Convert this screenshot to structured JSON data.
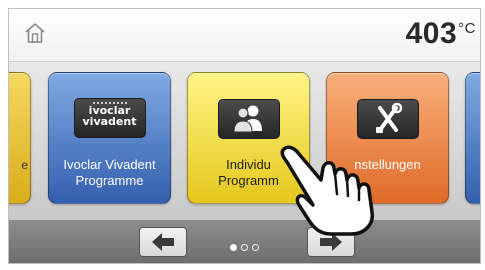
{
  "header": {
    "home_icon": "home-icon",
    "temperature_value": "403",
    "temperature_unit": "°C"
  },
  "tiles": [
    {
      "label": "e",
      "color": "#f0cc3e",
      "partial": true
    },
    {
      "label_line1": "Ivoclar Vivadent",
      "label_line2": "Programme",
      "logo_line1": "ivoclar",
      "logo_line2": "vivadent",
      "icon": "ivoclar-vivadent-logo",
      "color": "#4f7bc7"
    },
    {
      "label_line1": "Individu",
      "label_line2": "Programm",
      "icon": "users-icon",
      "color": "#f6e04a",
      "pressed": true
    },
    {
      "label": "nstellungen",
      "icon": "tools-icon",
      "color": "#ef8a47"
    },
    {
      "label": "",
      "color": "#4f7bc7",
      "partial": true
    }
  ],
  "footer": {
    "prev_icon": "arrow-left-icon",
    "next_icon": "arrow-right-icon",
    "page_current": 1,
    "page_count": 3
  },
  "overlay": {
    "icon": "pointing-hand-icon"
  }
}
